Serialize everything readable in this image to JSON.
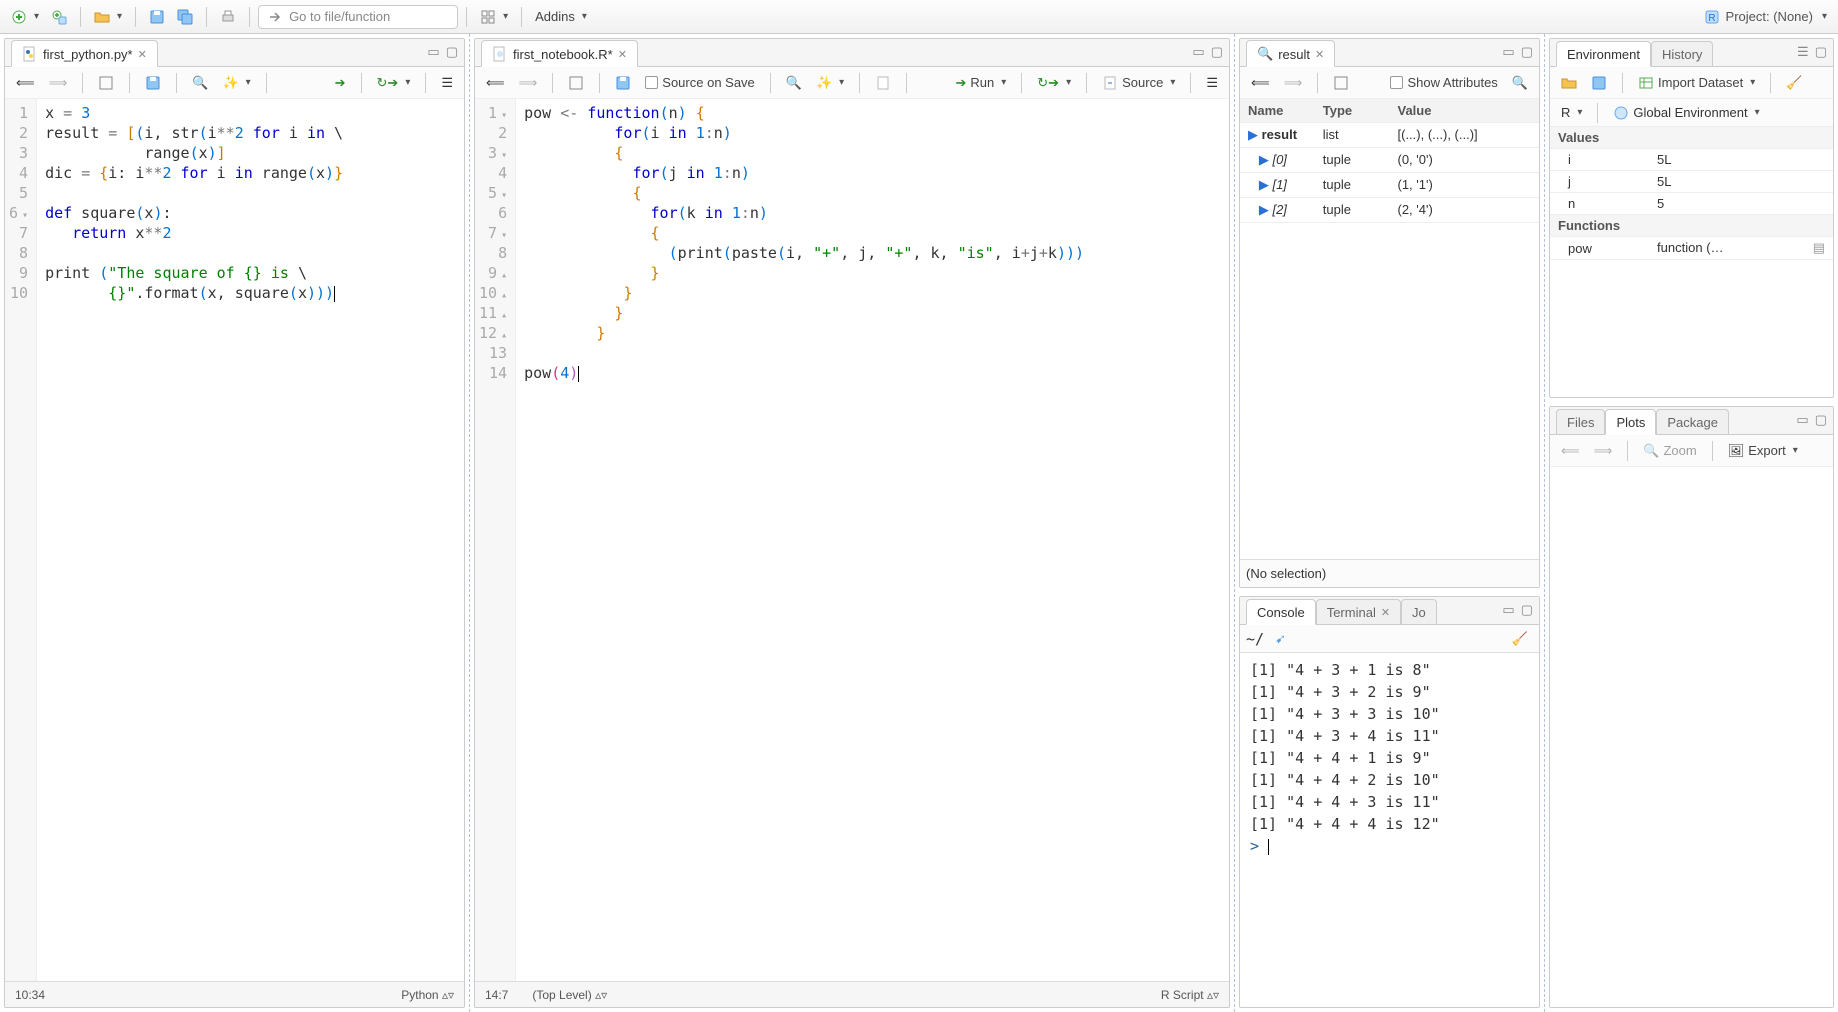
{
  "toolbar": {
    "goto_placeholder": "Go to file/function",
    "addins_label": "Addins",
    "project_label": "Project: (None)"
  },
  "editor1": {
    "tab_title": "first_python.py*",
    "cursor_pos": "10:34",
    "lang": "Python",
    "lines": [
      {
        "n": 1,
        "fold": "",
        "html": "x <span class='op'>=</span> <span class='num'>3</span>"
      },
      {
        "n": 2,
        "fold": "",
        "html": "result <span class='op'>=</span> <span class='brace'>[</span><span class='paren'>(</span>i, str<span class='paren'>(</span>i<span class='op'>**</span><span class='num'>2</span> <span class='kw'>for</span> i <span class='kw'>in</span> \\"
      },
      {
        "n": 3,
        "fold": "",
        "html": "           range<span class='paren'>(</span>x<span class='paren'>)</span><span class='brace'>]</span>"
      },
      {
        "n": 4,
        "fold": "",
        "html": "dic <span class='op'>=</span> <span class='brace'>{</span>i: i<span class='op'>**</span><span class='num'>2</span> <span class='kw'>for</span> i <span class='kw'>in</span> range<span class='paren'>(</span>x<span class='paren'>)</span><span class='brace'>}</span>"
      },
      {
        "n": 5,
        "fold": "",
        "html": ""
      },
      {
        "n": 6,
        "fold": "▾",
        "html": "<span class='kw'>def</span> square<span class='paren'>(</span>x<span class='paren'>)</span>:"
      },
      {
        "n": 7,
        "fold": "",
        "html": "   <span class='kw'>return</span> x<span class='op'>**</span><span class='num'>2</span>"
      },
      {
        "n": 8,
        "fold": "",
        "html": ""
      },
      {
        "n": 9,
        "fold": "",
        "html": "print <span class='paren'>(</span><span class='str'>\"The square of {} is </span>\\"
      },
      {
        "n": 10,
        "fold": "",
        "html": "       <span class='str'>{}\"</span>.format<span class='paren'>(</span>x, square<span class='paren'>(</span>x<span class='paren'>)))</span><span class='cursor'></span>"
      }
    ]
  },
  "editor2": {
    "tab_title": "first_notebook.R*",
    "cursor_pos": "14:7",
    "scope": "(Top Level)",
    "lang": "R Script",
    "source_on_save": "Source on Save",
    "run_label": "Run",
    "source_label": "Source",
    "lines": [
      {
        "n": 1,
        "fold": "▾",
        "html": "pow <span class='op'>&lt;-</span> <span class='kw'>function</span><span class='paren'>(</span>n<span class='paren'>)</span> <span class='brace'>{</span>"
      },
      {
        "n": 2,
        "fold": "",
        "html": "          <span class='kw'>for</span><span class='paren'>(</span>i <span class='kw'>in</span> <span class='num'>1</span><span class='op'>:</span>n<span class='paren'>)</span>"
      },
      {
        "n": 3,
        "fold": "▾",
        "html": "          <span class='brace'>{</span>"
      },
      {
        "n": 4,
        "fold": "",
        "html": "            <span class='kw'>for</span><span class='paren'>(</span>j <span class='kw'>in</span> <span class='num'>1</span><span class='op'>:</span>n<span class='paren'>)</span>"
      },
      {
        "n": 5,
        "fold": "▾",
        "html": "            <span class='brace'>{</span>"
      },
      {
        "n": 6,
        "fold": "",
        "html": "              <span class='kw'>for</span><span class='paren'>(</span>k <span class='kw'>in</span> <span class='num'>1</span><span class='op'>:</span>n<span class='paren'>)</span>"
      },
      {
        "n": 7,
        "fold": "▾",
        "html": "              <span class='brace'>{</span>"
      },
      {
        "n": 8,
        "fold": "",
        "html": "                <span class='paren'>(</span>print<span class='paren'>(</span>paste<span class='paren'>(</span>i, <span class='str'>\"+\"</span>, j, <span class='str'>\"+\"</span>, k, <span class='str'>\"is\"</span>, i<span class='op'>+</span>j<span class='op'>+</span>k<span class='paren'>)))</span>"
      },
      {
        "n": 9,
        "fold": "▴",
        "html": "              <span class='brace'>}</span>"
      },
      {
        "n": 10,
        "fold": "▴",
        "html": "           <span class='brace'>}</span>"
      },
      {
        "n": 11,
        "fold": "▴",
        "html": "          <span class='brace'>}</span>"
      },
      {
        "n": 12,
        "fold": "▴",
        "html": "        <span class='brace'>}</span>"
      },
      {
        "n": 13,
        "fold": "",
        "html": ""
      },
      {
        "n": 14,
        "fold": "",
        "html": "pow<span class='pinka'>(</span><span class='num'>4</span><span class='pinkb'>)</span><span class='cursor'></span>"
      }
    ]
  },
  "inspector": {
    "search_value": "result",
    "show_attributes": "Show Attributes",
    "cols": {
      "name": "Name",
      "type": "Type",
      "value": "Value"
    },
    "rows": [
      {
        "icon": "play",
        "name": "result",
        "type": "list",
        "value": "[(...), (...), (...)]"
      },
      {
        "icon": "play-s",
        "name": "[0]",
        "type": "tuple",
        "value": "(0, '0')"
      },
      {
        "icon": "play-s",
        "name": "[1]",
        "type": "tuple",
        "value": "(1, '1')"
      },
      {
        "icon": "play-s",
        "name": "[2]",
        "type": "tuple",
        "value": "(2, '4')"
      }
    ],
    "noselection": "(No selection)"
  },
  "console": {
    "tabs": {
      "console": "Console",
      "terminal": "Terminal",
      "jobs": "Jo"
    },
    "wd": "~/",
    "lines": [
      "[1]  \"4 + 3 + 1 is 8\"",
      "[1]  \"4 + 3 + 2 is 9\"",
      "[1]  \"4 + 3 + 3 is 10\"",
      "[1]  \"4 + 3 + 4 is 11\"",
      "[1]  \"4 + 4 + 1 is 9\"",
      "[1]  \"4 + 4 + 2 is 10\"",
      "[1]  \"4 + 4 + 3 is 11\"",
      "[1]  \"4 + 4 + 4 is 12\""
    ],
    "prompt": ">"
  },
  "env": {
    "tabs": {
      "env": "Environment",
      "hist": "History"
    },
    "import": "Import Dataset",
    "scope_r": "R",
    "scope_global": "Global Environment",
    "values_hdr": "Values",
    "functions_hdr": "Functions",
    "rows": [
      {
        "k": "i",
        "v": "5L"
      },
      {
        "k": "j",
        "v": "5L"
      },
      {
        "k": "n",
        "v": "5"
      }
    ],
    "funcs": [
      {
        "k": "pow",
        "v": "function (…"
      }
    ]
  },
  "plots": {
    "tabs": {
      "files": "Files",
      "plots": "Plots",
      "packages": "Package"
    },
    "zoom": "Zoom",
    "export": "Export"
  }
}
